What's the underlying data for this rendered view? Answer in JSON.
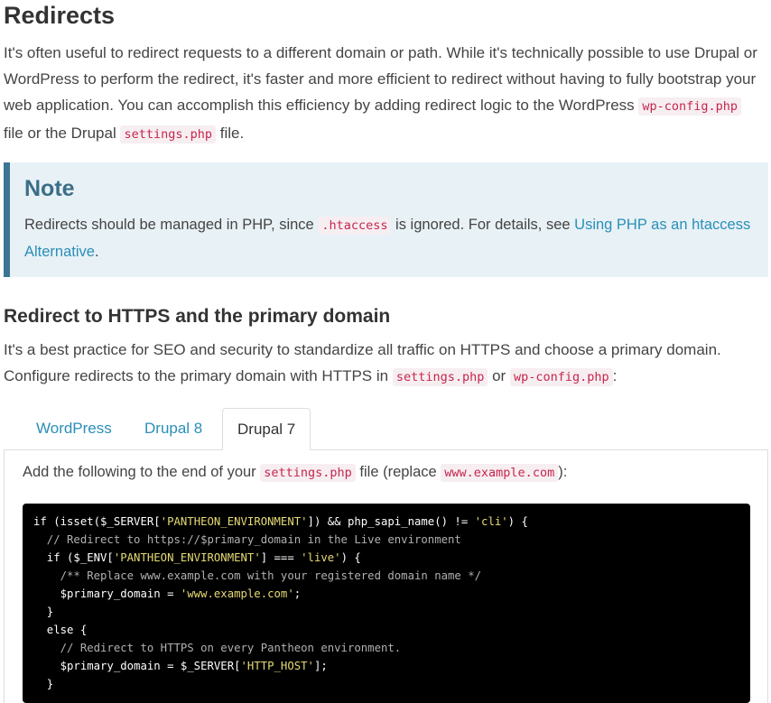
{
  "section": {
    "title": "Redirects",
    "intro": {
      "text1": "It's often useful to redirect requests to a different domain or path. While it's technically possible to use Drupal or WordPress to perform the redirect, it's faster and more efficient to redirect without having to fully bootstrap your web application. You can accomplish this efficiency by adding redirect logic to the WordPress ",
      "code1": "wp-config.php",
      "text2": " file or the Drupal ",
      "code2": "settings.php",
      "text3": " file."
    }
  },
  "note": {
    "title": "Note",
    "text1": "Redirects should be managed in PHP, since ",
    "code1": ".htaccess",
    "text2": " is ignored. For details, see ",
    "link": "Using PHP as an htaccess Alternative",
    "text3": "."
  },
  "subsection": {
    "title": "Redirect to HTTPS and the primary domain",
    "text1": "It's a best practice for SEO and security to standardize all traffic on HTTPS and choose a primary domain. Configure redirects to the primary domain with HTTPS in ",
    "code1": "settings.php",
    "text2": " or ",
    "code2": "wp-config.php",
    "text3": ":"
  },
  "tabs": [
    {
      "label": "WordPress",
      "active": false
    },
    {
      "label": "Drupal 8",
      "active": false
    },
    {
      "label": "Drupal 7",
      "active": true
    }
  ],
  "panel": {
    "text1": "Add the following to the end of your ",
    "code1": "settings.php",
    "text2": " file (replace ",
    "code2": "www.example.com",
    "text3": "):"
  },
  "code_lines": [
    [
      {
        "t": "if (isset($_SERVER["
      },
      {
        "t": "'PANTHEON_ENVIRONMENT'",
        "k": "str"
      },
      {
        "t": "]) && php_sapi_name() != "
      },
      {
        "t": "'cli'",
        "k": "str"
      },
      {
        "t": ") {"
      }
    ],
    [
      {
        "t": "  // Redirect to https://$primary_domain in the Live environment",
        "k": "cm"
      }
    ],
    [
      {
        "t": "  if ($_ENV["
      },
      {
        "t": "'PANTHEON_ENVIRONMENT'",
        "k": "str"
      },
      {
        "t": "] === "
      },
      {
        "t": "'live'",
        "k": "str"
      },
      {
        "t": ") {"
      }
    ],
    [
      {
        "t": "    /** Replace www.example.com with your registered domain name */",
        "k": "cm"
      }
    ],
    [
      {
        "t": "    $primary_domain = "
      },
      {
        "t": "'www.example.com'",
        "k": "str"
      },
      {
        "t": ";"
      }
    ],
    [
      {
        "t": "  }"
      }
    ],
    [
      {
        "t": "  else {"
      }
    ],
    [
      {
        "t": "    // Redirect to HTTPS on every Pantheon environment.",
        "k": "cm"
      }
    ],
    [
      {
        "t": "    $primary_domain = $_SERVER["
      },
      {
        "t": "'HTTP_HOST'",
        "k": "str"
      },
      {
        "t": "];"
      }
    ],
    [
      {
        "t": "  }"
      }
    ]
  ]
}
